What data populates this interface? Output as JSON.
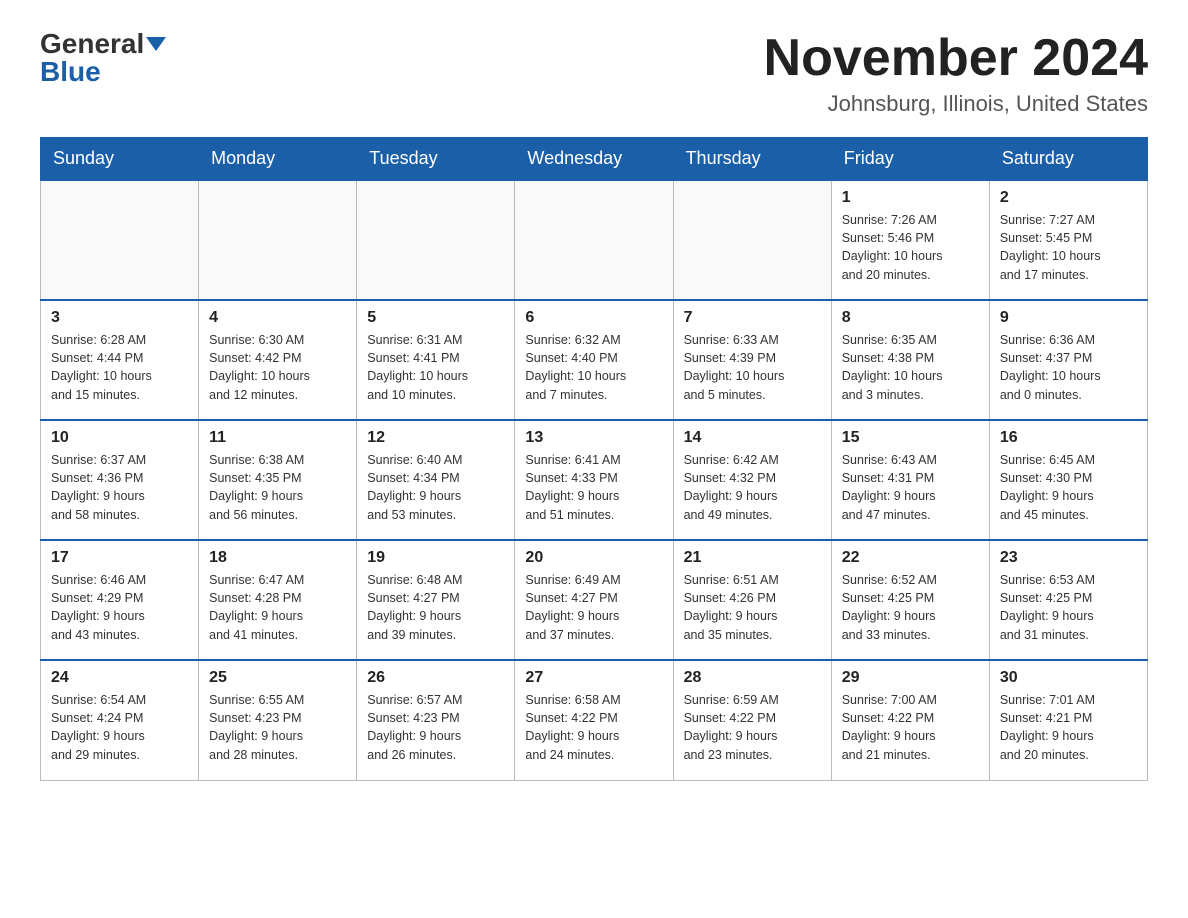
{
  "header": {
    "logo_general": "General",
    "logo_blue": "Blue",
    "month": "November 2024",
    "location": "Johnsburg, Illinois, United States"
  },
  "weekdays": [
    "Sunday",
    "Monday",
    "Tuesday",
    "Wednesday",
    "Thursday",
    "Friday",
    "Saturday"
  ],
  "weeks": [
    [
      {
        "day": "",
        "info": ""
      },
      {
        "day": "",
        "info": ""
      },
      {
        "day": "",
        "info": ""
      },
      {
        "day": "",
        "info": ""
      },
      {
        "day": "",
        "info": ""
      },
      {
        "day": "1",
        "info": "Sunrise: 7:26 AM\nSunset: 5:46 PM\nDaylight: 10 hours\nand 20 minutes."
      },
      {
        "day": "2",
        "info": "Sunrise: 7:27 AM\nSunset: 5:45 PM\nDaylight: 10 hours\nand 17 minutes."
      }
    ],
    [
      {
        "day": "3",
        "info": "Sunrise: 6:28 AM\nSunset: 4:44 PM\nDaylight: 10 hours\nand 15 minutes."
      },
      {
        "day": "4",
        "info": "Sunrise: 6:30 AM\nSunset: 4:42 PM\nDaylight: 10 hours\nand 12 minutes."
      },
      {
        "day": "5",
        "info": "Sunrise: 6:31 AM\nSunset: 4:41 PM\nDaylight: 10 hours\nand 10 minutes."
      },
      {
        "day": "6",
        "info": "Sunrise: 6:32 AM\nSunset: 4:40 PM\nDaylight: 10 hours\nand 7 minutes."
      },
      {
        "day": "7",
        "info": "Sunrise: 6:33 AM\nSunset: 4:39 PM\nDaylight: 10 hours\nand 5 minutes."
      },
      {
        "day": "8",
        "info": "Sunrise: 6:35 AM\nSunset: 4:38 PM\nDaylight: 10 hours\nand 3 minutes."
      },
      {
        "day": "9",
        "info": "Sunrise: 6:36 AM\nSunset: 4:37 PM\nDaylight: 10 hours\nand 0 minutes."
      }
    ],
    [
      {
        "day": "10",
        "info": "Sunrise: 6:37 AM\nSunset: 4:36 PM\nDaylight: 9 hours\nand 58 minutes."
      },
      {
        "day": "11",
        "info": "Sunrise: 6:38 AM\nSunset: 4:35 PM\nDaylight: 9 hours\nand 56 minutes."
      },
      {
        "day": "12",
        "info": "Sunrise: 6:40 AM\nSunset: 4:34 PM\nDaylight: 9 hours\nand 53 minutes."
      },
      {
        "day": "13",
        "info": "Sunrise: 6:41 AM\nSunset: 4:33 PM\nDaylight: 9 hours\nand 51 minutes."
      },
      {
        "day": "14",
        "info": "Sunrise: 6:42 AM\nSunset: 4:32 PM\nDaylight: 9 hours\nand 49 minutes."
      },
      {
        "day": "15",
        "info": "Sunrise: 6:43 AM\nSunset: 4:31 PM\nDaylight: 9 hours\nand 47 minutes."
      },
      {
        "day": "16",
        "info": "Sunrise: 6:45 AM\nSunset: 4:30 PM\nDaylight: 9 hours\nand 45 minutes."
      }
    ],
    [
      {
        "day": "17",
        "info": "Sunrise: 6:46 AM\nSunset: 4:29 PM\nDaylight: 9 hours\nand 43 minutes."
      },
      {
        "day": "18",
        "info": "Sunrise: 6:47 AM\nSunset: 4:28 PM\nDaylight: 9 hours\nand 41 minutes."
      },
      {
        "day": "19",
        "info": "Sunrise: 6:48 AM\nSunset: 4:27 PM\nDaylight: 9 hours\nand 39 minutes."
      },
      {
        "day": "20",
        "info": "Sunrise: 6:49 AM\nSunset: 4:27 PM\nDaylight: 9 hours\nand 37 minutes."
      },
      {
        "day": "21",
        "info": "Sunrise: 6:51 AM\nSunset: 4:26 PM\nDaylight: 9 hours\nand 35 minutes."
      },
      {
        "day": "22",
        "info": "Sunrise: 6:52 AM\nSunset: 4:25 PM\nDaylight: 9 hours\nand 33 minutes."
      },
      {
        "day": "23",
        "info": "Sunrise: 6:53 AM\nSunset: 4:25 PM\nDaylight: 9 hours\nand 31 minutes."
      }
    ],
    [
      {
        "day": "24",
        "info": "Sunrise: 6:54 AM\nSunset: 4:24 PM\nDaylight: 9 hours\nand 29 minutes."
      },
      {
        "day": "25",
        "info": "Sunrise: 6:55 AM\nSunset: 4:23 PM\nDaylight: 9 hours\nand 28 minutes."
      },
      {
        "day": "26",
        "info": "Sunrise: 6:57 AM\nSunset: 4:23 PM\nDaylight: 9 hours\nand 26 minutes."
      },
      {
        "day": "27",
        "info": "Sunrise: 6:58 AM\nSunset: 4:22 PM\nDaylight: 9 hours\nand 24 minutes."
      },
      {
        "day": "28",
        "info": "Sunrise: 6:59 AM\nSunset: 4:22 PM\nDaylight: 9 hours\nand 23 minutes."
      },
      {
        "day": "29",
        "info": "Sunrise: 7:00 AM\nSunset: 4:22 PM\nDaylight: 9 hours\nand 21 minutes."
      },
      {
        "day": "30",
        "info": "Sunrise: 7:01 AM\nSunset: 4:21 PM\nDaylight: 9 hours\nand 20 minutes."
      }
    ]
  ]
}
